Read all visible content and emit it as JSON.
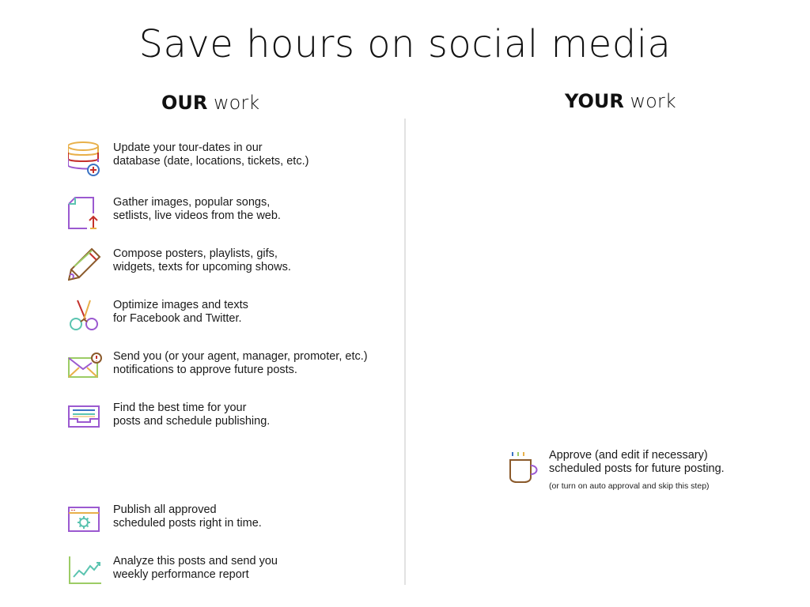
{
  "title": "Save hours on social media",
  "columns": {
    "ours": {
      "strong": "OUR",
      "light": "work"
    },
    "yours": {
      "strong": "YOUR",
      "light": "work"
    }
  },
  "our_tasks": [
    {
      "icon": "database-add-icon",
      "line1": "Update your tour-dates in our",
      "line2": "database (date, locations, tickets, etc.)"
    },
    {
      "icon": "file-upload-icon",
      "line1": "Gather images, popular songs,",
      "line2": "setlists, live videos from the web."
    },
    {
      "icon": "pencil-icon",
      "line1": "Compose posters, playlists, gifs,",
      "line2": "widgets, texts for upcoming shows."
    },
    {
      "icon": "scissors-icon",
      "line1": "Optimize images and texts",
      "line2": "for Facebook and Twitter."
    },
    {
      "icon": "mail-notification-icon",
      "line1": "Send you (or your agent, manager, promoter, etc.)",
      "line2": "notifications to approve future posts."
    },
    {
      "icon": "schedule-tray-icon",
      "line1": "Find the best time for your",
      "line2": "posts and schedule publishing."
    },
    {
      "icon": "browser-settings-icon",
      "line1": "Publish all approved",
      "line2": "scheduled posts right in time."
    },
    {
      "icon": "analytics-chart-icon",
      "line1": "Analyze this posts and send you",
      "line2": "weekly performance report"
    }
  ],
  "your_task": {
    "icon": "coffee-cup-icon",
    "line1": "Approve (and edit if necessary)",
    "line2": "scheduled posts for future posting.",
    "note": "(or turn on auto approval and skip this step)"
  }
}
